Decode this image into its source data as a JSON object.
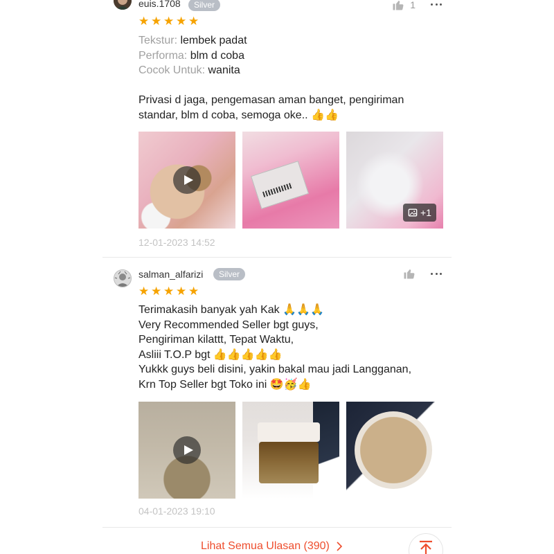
{
  "reviews": [
    {
      "username": "euis.1708",
      "badge": "Silver",
      "like_count": "1",
      "rating": 5,
      "attributes": [
        {
          "key": "Tekstur:",
          "value": "lembek padat"
        },
        {
          "key": "Performa:",
          "value": "blm d coba"
        },
        {
          "key": "Cocok Untuk:",
          "value": "wanita"
        }
      ],
      "body": "Privasi d jaga, pengemasan aman banget, pengiriman standar, blm d coba, semoga oke.. 👍👍",
      "more_images_label": "+1",
      "timestamp": "12-01-2023 14:52"
    },
    {
      "username": "salman_alfarizi",
      "badge": "Silver",
      "rating": 5,
      "body": "Terimakasih banyak yah Kak 🙏🙏🙏\nVery Recommended Seller bgt guys,\nPengiriman kilattt, Tepat Waktu,\n Asliii T.O.P bgt 👍👍👍👍👍\nYukkk guys beli disini, yakin bakal mau jadi Langganan,\nKrn Top Seller bgt Toko ini 🤩🥳👍",
      "timestamp": "04-01-2023 19:10"
    }
  ],
  "footer": {
    "see_all_label": "Lihat Semua Ulasan (390)"
  },
  "icons": {
    "like": "thumbs-up-icon",
    "more": "more-horizontal-icon",
    "play": "play-icon",
    "image": "image-icon",
    "chevron": "chevron-right-icon",
    "back_to_top": "arrow-up-to-top-icon"
  },
  "colors": {
    "star": "#f6a300",
    "accent": "#ee4d2d",
    "badge": "#b9bec6"
  }
}
